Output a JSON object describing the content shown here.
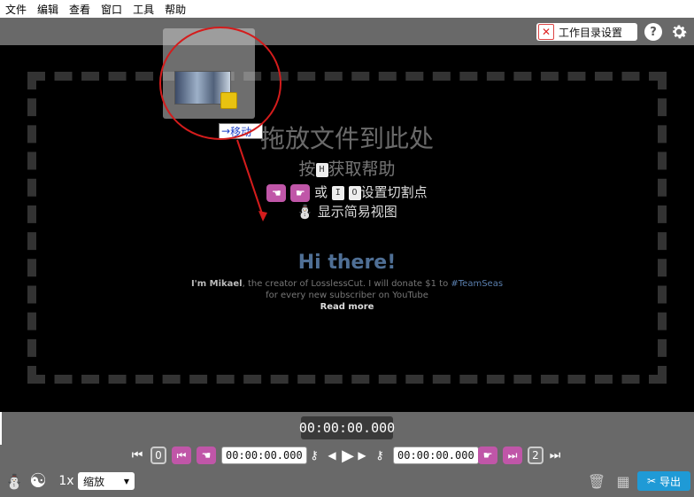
{
  "menu": [
    "文件",
    "编辑",
    "查看",
    "窗口",
    "工具",
    "帮助"
  ],
  "topbar": {
    "working_dir_label": "工作目录设置",
    "help": "?"
  },
  "drop": {
    "title": "拖放文件到此处",
    "help_prefix": "按",
    "help_key": "H",
    "help_suffix": "获取帮助",
    "cut_or": "或",
    "key_in": "I",
    "key_out": "O",
    "cut_suffix": "设置切割点",
    "simple_view": "显示简易视图"
  },
  "promo": {
    "title": "Hi there!",
    "line1_bold": "I'm Mikael",
    "line1_rest": ", the creator of LosslessCut. I will donate $1 to ",
    "hashtag": "#TeamSeas",
    "line2": "for every new subscriber on YouTube",
    "read_more": "Read more"
  },
  "drag": {
    "move_label": "移动"
  },
  "timeline": {
    "current_time": "00:00:00.000"
  },
  "controls": {
    "start_num": "0",
    "start_time": "00:00:00.000",
    "end_time": "00:00:00.000",
    "end_num": "2",
    "rate": "1x",
    "zoom": "缩放",
    "export": "导出"
  },
  "colors": {
    "pink": "#c056a8",
    "export_blue": "#1f9ad6",
    "highlight_red": "#d41c1c"
  }
}
